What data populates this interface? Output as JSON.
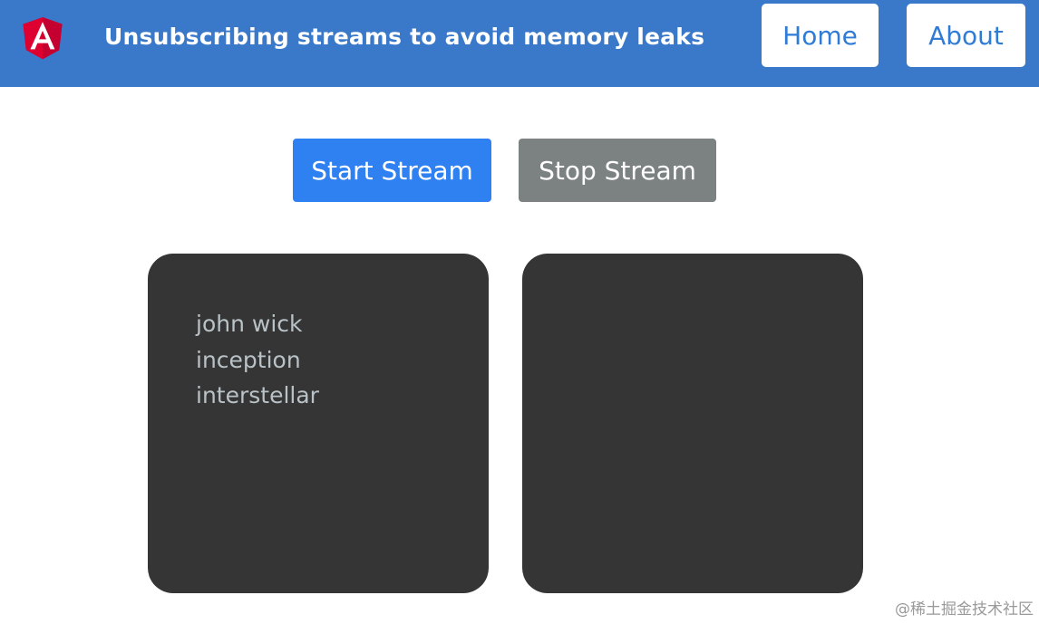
{
  "header": {
    "title": "Unsubscribing streams to avoid memory leaks",
    "logo_letter": "A",
    "nav": [
      {
        "label": "Home"
      },
      {
        "label": "About"
      }
    ]
  },
  "controls": {
    "start_label": "Start Stream",
    "stop_label": "Stop Stream"
  },
  "panels": {
    "left_items": [
      "john wick",
      "inception",
      "interstellar"
    ]
  },
  "watermark": "@稀土掘金技术社区",
  "colors": {
    "header_bg": "#3a78c9",
    "start_button": "#2f80f0",
    "stop_button": "#7c8282",
    "panel_bg": "#353535",
    "panel_text": "#b9c2c6",
    "nav_text": "#2f7bd6"
  },
  "icons": {
    "logo": "angular-logo-icon"
  }
}
